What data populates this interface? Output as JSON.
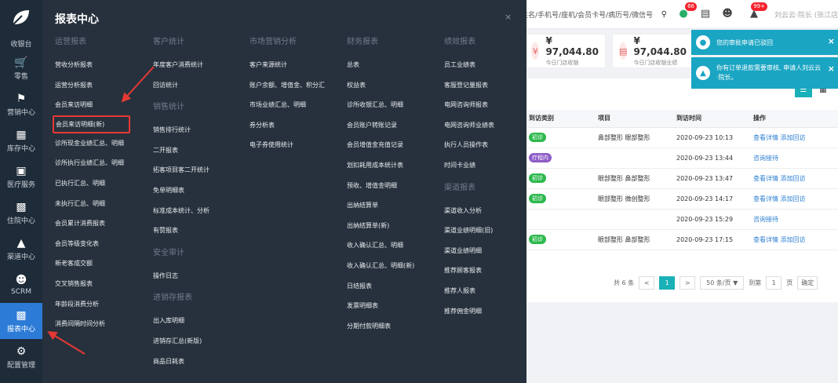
{
  "sidebar": {
    "items": [
      {
        "label": "收银台",
        "icon": "cashier-icon"
      },
      {
        "label": "零售",
        "icon": "cart-icon"
      },
      {
        "label": "营销中心",
        "icon": "megaphone-icon"
      },
      {
        "label": "库存中心",
        "icon": "grid-icon"
      },
      {
        "label": "医疗服务",
        "icon": "medical-kit-icon"
      },
      {
        "label": "住院中心",
        "icon": "building-icon"
      },
      {
        "label": "渠道中心",
        "icon": "network-icon"
      },
      {
        "label": "SCRM",
        "icon": "users-icon"
      },
      {
        "label": "报表中心",
        "icon": "bar-chart-icon",
        "active": true
      },
      {
        "label": "配置管理",
        "icon": "gear-icon"
      }
    ]
  },
  "topbar": {
    "search_placeholder": "姓名/手机号/座机/会员卡号/病历号/微信号",
    "wechat_badge": "66",
    "bell_badge": "99+",
    "user": "刘云云·院长 (张江店)"
  },
  "stats": [
    {
      "value": "¥ 97,044.80",
      "label": "今日门店收银"
    },
    {
      "value": "¥ 97,044.80",
      "label": "今日门店收银业绩"
    }
  ],
  "notifications": [
    {
      "text": "您的审批申请已驳回"
    },
    {
      "text": "你有订单退款需要审核, 申请人刘云云·院长。"
    }
  ],
  "table": {
    "headers": [
      "到访类别",
      "项目",
      "到访时间",
      "操作"
    ],
    "rows": [
      {
        "tag": "初诊",
        "tag_color": "#2db84d",
        "project": "鼻部整形 眼部整形",
        "time": "2020-09-23 10:13",
        "ops": [
          "查看详情",
          "添加回访"
        ]
      },
      {
        "tag": "疗程内",
        "tag_color": "#8e5cc7",
        "project": "",
        "time": "2020-09-23 13:44",
        "ops": [
          "咨询接待"
        ]
      },
      {
        "tag": "初诊",
        "tag_color": "#2db84d",
        "project": "眼部整形 鼻部整形",
        "time": "2020-09-23 13:47",
        "ops": [
          "查看详情",
          "添加回访"
        ]
      },
      {
        "tag": "初诊",
        "tag_color": "#2db84d",
        "project": "眼部整形 微创整形",
        "time": "2020-09-23 14:17",
        "ops": [
          "查看详情",
          "添加回访"
        ]
      },
      {
        "tag": "",
        "tag_color": "",
        "project": "",
        "time": "2020-09-23 15:29",
        "ops": [
          "咨询接待"
        ]
      },
      {
        "tag": "初诊",
        "tag_color": "#2db84d",
        "project": "眼部整形 鼻部整形",
        "time": "2020-09-23 17:15",
        "ops": [
          "查看详情",
          "添加回访"
        ]
      }
    ]
  },
  "pager": {
    "total": "共 6 条",
    "prev": "<",
    "page": "1",
    "next": ">",
    "size": "50 条/页 ▼",
    "goto": "到第",
    "goto_val": "1",
    "page_unit": "页",
    "confirm": "确定"
  },
  "menu": {
    "title": "报表中心",
    "close": "×",
    "columns": [
      {
        "sections": [
          {
            "title": "运营报表",
            "items": [
              "营收分析报表",
              "运营分析报表",
              "会员来访明细",
              "会员来访明细(新)",
              "诊所现金业绩汇总、明细",
              "诊所执行业绩汇总、明细",
              "已执行汇总、明细",
              "未执行汇总、明细",
              "会员累计消费报表",
              "会员等级变化表",
              "新老客成交额",
              "交叉销售报表",
              "年龄段消费分析",
              "消费间隔时间分析"
            ]
          }
        ]
      },
      {
        "sections": [
          {
            "title": "客户统计",
            "items": [
              "年度客户消费统计",
              "回访统计"
            ]
          },
          {
            "title": "销售统计",
            "items": [
              "销售排行统计",
              "二开报表",
              "拓客项目客二开统计",
              "免单明细表",
              "标准成本统计、分析",
              "有赞报表"
            ]
          },
          {
            "title": "安全审计",
            "items": [
              "操作日志"
            ]
          },
          {
            "title": "进销存报表",
            "items": [
              "出入库明细",
              "进销存汇总(新版)",
              "商品日耗表"
            ]
          }
        ]
      },
      {
        "sections": [
          {
            "title": "市场营销分析",
            "items": [
              "客户来源统计",
              "账户余额、增值金、积分汇",
              "市场业绩汇总、明细",
              "券分析表",
              "电子券使用统计"
            ]
          }
        ]
      },
      {
        "sections": [
          {
            "title": "财务报表",
            "items": [
              "总表",
              "权益表",
              "诊所收银汇总、明细",
              "会员账户转账记录",
              "会员增值金充值记录",
              "划扣耗用成本统计表",
              "预收、增值金明细",
              "出纳结算单",
              "出纳结算单(新)",
              "收入确认汇总、明细",
              "收入确认汇总、明细(新)",
              "日结报表",
              "发票明细表",
              "分期付款明细表"
            ]
          }
        ]
      },
      {
        "sections": [
          {
            "title": "绩效报表",
            "items": [
              "员工业绩表",
              "客服登记量报表",
              "电网咨询师报表",
              "电网咨询师业绩表",
              "执行人员操作表",
              "时间卡业绩"
            ]
          },
          {
            "title": "渠道报表",
            "items": [
              "渠道收入分析",
              "渠道业绩明细(旧)",
              "渠道业绩明细",
              "推荐顾客报表",
              "推荐人报表",
              "推荐佣金明细"
            ]
          }
        ]
      }
    ]
  }
}
